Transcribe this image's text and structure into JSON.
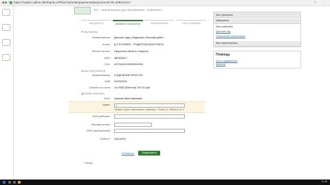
{
  "browser": {
    "url": "https://node2.online.sberbank.ru/PhizIC/private/payments/payment.do?id=308222417",
    "right_icons": "☆ ⋮"
  },
  "header": {
    "banner_text": "Тут... назначенные для заполнения - отмечены *"
  },
  "steps": [
    {
      "label": "ввод данных"
    },
    {
      "label": "реквизиты получателя"
    },
    {
      "label": "подтверждение"
    },
    {
      "label": "статус операции"
    }
  ],
  "recipient": {
    "title": "Получатель",
    "rows": [
      {
        "label": "Наименование:",
        "value": "Детские сады (Ладиково) Ленский район"
      },
      {
        "label": "Услуга:",
        "value": "Д СТОЛОВОЕ - РОДИТЕЛЬСКАЯ ПЛАТА"
      },
      {
        "label": "Регион оплаты:",
        "value": "Иркутская область г.Иркутск"
      },
      {
        "label": "ИНН:",
        "value": "382500017"
      },
      {
        "label": "Счёт:",
        "value": "40701810100000000003"
      }
    ]
  },
  "bank": {
    "title": "Банк получателя",
    "rows": [
      {
        "label": "Наименование:",
        "value": "ОТДЕЛЕНИЕ ИРКУТСК"
      },
      {
        "label": "БИК:",
        "value": "042520001"
      },
      {
        "label": "Списать со счета:",
        "value": "•••• 5582 [Electron] 700.92 руб."
      }
    ]
  },
  "payment": {
    "title": "Детали платежа",
    "rows": [
      {
        "label": "ФИО:",
        "value": "Иванов Иван Иванович"
      },
      {
        "label": "Адрес:",
        "value": "|"
      },
      {
        "label": "ФИО ребенка*:",
        "value": ""
      },
      {
        "label": "Период оплаты:",
        "value": ""
      },
      {
        "label": "ИНН (при наличии):",
        "value": ""
      },
      {
        "label": "СИПКО*:",
        "value": "23414000"
      }
    ],
    "address_hint": "Введите адрес плательщика, например: г. Псков, ул. Ленина 5, кв. 1"
  },
  "actions": {
    "cancel": "Отменить",
    "next": "Продолжить",
    "back": "← Назад"
  },
  "sidebar": {
    "items": [
      {
        "label": "Мои финансы"
      },
      {
        "label": "Избранное"
      },
      {
        "label": "Мои шаблоны"
      },
      {
        "label": "Детский сад"
      },
      {
        "label": "Управление шаблонами"
      },
      {
        "label": "Мои автоплатежи"
      }
    ]
  },
  "help": {
    "title": "Помощь",
    "links": [
      "Часто задаваемые",
      "вопросы"
    ]
  },
  "taskbar": {
    "clock": "11:45"
  }
}
